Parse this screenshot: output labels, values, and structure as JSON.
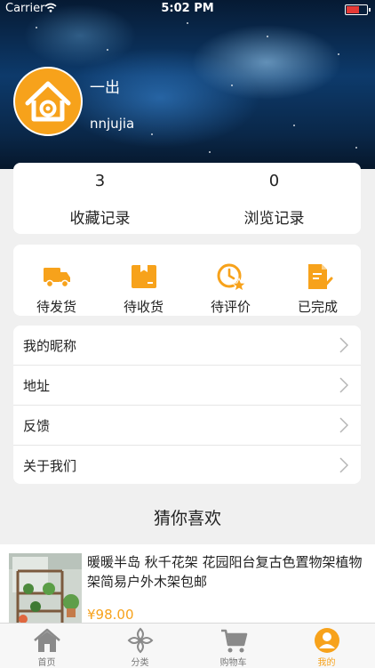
{
  "status_bar": {
    "carrier": "Carrier",
    "time": "5:02 PM"
  },
  "profile": {
    "name": "一出",
    "account": "nnjujia"
  },
  "stats": [
    {
      "count": "3",
      "label": "收藏记录"
    },
    {
      "count": "0",
      "label": "浏览记录"
    }
  ],
  "orders": [
    {
      "label": "待发货",
      "icon": "truck-icon"
    },
    {
      "label": "待收货",
      "icon": "box-icon"
    },
    {
      "label": "待评价",
      "icon": "clock-star-icon"
    },
    {
      "label": "已完成",
      "icon": "document-check-icon"
    }
  ],
  "menu": [
    {
      "label": "我的昵称"
    },
    {
      "label": "地址"
    },
    {
      "label": "反馈"
    },
    {
      "label": "关于我们"
    }
  ],
  "recommend": {
    "title": "猜你喜欢",
    "product": {
      "title": "暖暖半岛 秋千花架 花园阳台复古色置物架植物架简易户外木架包邮",
      "price": "¥98.00"
    }
  },
  "tabbar": [
    {
      "label": "首页",
      "icon": "home-icon"
    },
    {
      "label": "分类",
      "icon": "category-icon"
    },
    {
      "label": "购物车",
      "icon": "cart-icon"
    },
    {
      "label": "我的",
      "icon": "user-icon",
      "active": true
    }
  ],
  "colors": {
    "accent": "#f7a21b",
    "background": "#f0f0f0"
  }
}
